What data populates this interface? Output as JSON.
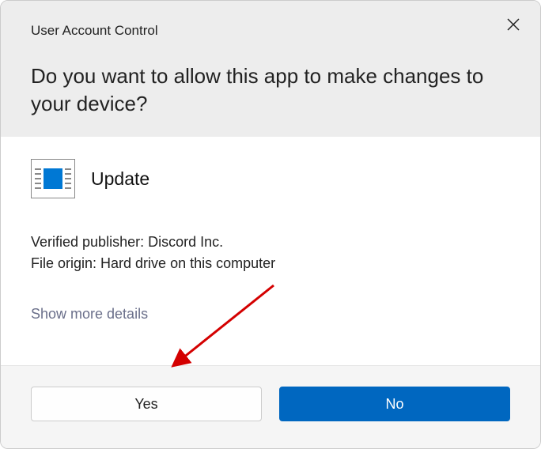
{
  "header": {
    "small_title": "User Account Control",
    "big_title": "Do you want to allow this app to make changes to your device?"
  },
  "content": {
    "app_name": "Update",
    "publisher_line": "Verified publisher: Discord Inc.",
    "origin_line": "File origin: Hard drive on this computer",
    "details_link": "Show more details"
  },
  "footer": {
    "yes_label": "Yes",
    "no_label": "No"
  }
}
